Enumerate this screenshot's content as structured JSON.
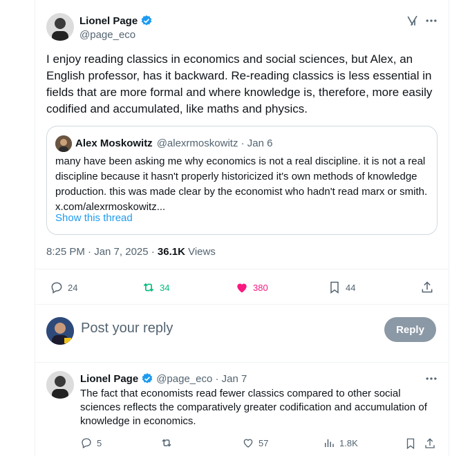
{
  "main_tweet": {
    "author_name": "Lionel Page",
    "author_handle": "@page_eco",
    "text": "I enjoy reading classics in economics and social sciences, but Alex, an English professor, has it backward. Re-reading classics is less essential in fields that are more formal and where knowledge is, therefore, more easily codified and accumulated, like maths and physics.",
    "time": "8:25 PM · Jan 7, 2025 · ",
    "views_count": "36.1K",
    "views_label": " Views",
    "stats": {
      "replies": "24",
      "reposts": "34",
      "likes": "380",
      "bookmarks": "44"
    }
  },
  "quoted_tweet": {
    "author_name": "Alex Moskowitz",
    "author_handle": "@alexrmoskowitz · Jan 6",
    "text": "many have been asking me why economics is not a real discipline. it is not a real discipline because it hasn't properly historicized it's own methods of knowledge production. this was made clear by the economist who hadn't read marx or smith. x.com/alexrmoskowitz...",
    "show_thread": "Show this thread"
  },
  "composer": {
    "placeholder": "Post your reply",
    "button_label": "Reply"
  },
  "reply_tweet": {
    "author_name": "Lionel Page",
    "author_handle": "@page_eco · Jan 7",
    "text": "The fact that economists read fewer classics compared to other social sciences reflects the comparatively greater codification and accumulation of knowledge in economics.",
    "stats": {
      "replies": "5",
      "likes": "57",
      "views": "1.8K"
    }
  },
  "colors": {
    "accent": "#1d9bf0",
    "repost": "#00ba7c",
    "like": "#f91880",
    "muted": "#536471"
  },
  "icons": [
    "grok-icon",
    "more-icon",
    "verified-badge-icon",
    "reply-icon",
    "repost-icon",
    "like-icon",
    "bookmark-icon",
    "share-icon",
    "views-icon"
  ]
}
